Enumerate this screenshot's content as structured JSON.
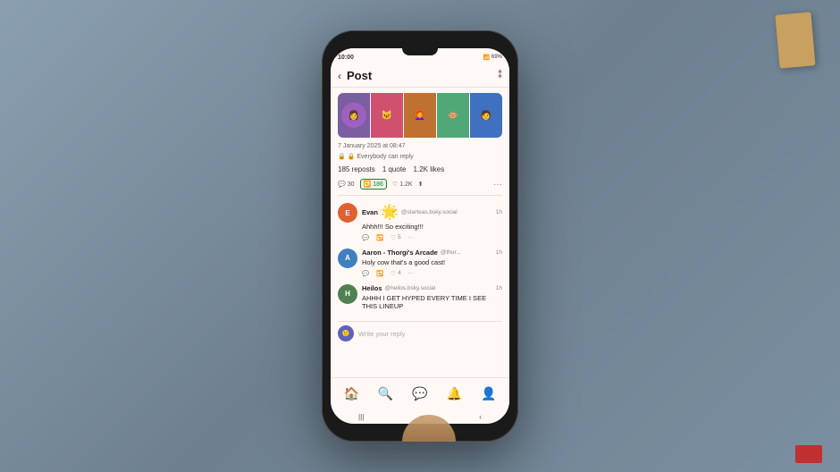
{
  "status_bar": {
    "time": "10:00",
    "battery": "69%",
    "signal_icons": "▲▼ 📶"
  },
  "header": {
    "title": "Post",
    "back_label": "‹",
    "icon": "⁑"
  },
  "post": {
    "date": "7 January 2025 at 08:47",
    "reply_note": "🔒 Everybody can reply",
    "reposts": "185 reposts",
    "quote": "1 quote",
    "likes": "1.2K likes"
  },
  "action_bar": {
    "comment_count": "30",
    "repost_count": "186",
    "like_count": "1.2K",
    "comment_icon": "💬",
    "repost_icon": "🔁",
    "like_icon": "♡",
    "share_icon": "⬆",
    "more_icon": "···"
  },
  "comments": [
    {
      "name": "Evan",
      "emoji": "🌟",
      "handle": "@starteas.bsky.social",
      "time": "1h",
      "text": "Ahhh!!! So exciting!!!",
      "avatar_color": "#e06030",
      "avatar_letter": "E",
      "actions": {
        "reply": "",
        "repost": "",
        "likes": "5",
        "more": "···"
      }
    },
    {
      "name": "Aaron - Thorgi's Arcade",
      "handle": "@thor...",
      "time": "1h",
      "text": "Holy cow that's a good cast!",
      "avatar_color": "#4080c0",
      "avatar_letter": "A",
      "actions": {
        "reply": "",
        "repost": "",
        "likes": "4",
        "more": "···"
      }
    },
    {
      "name": "Heilos",
      "handle": "@heilos.bsky.social",
      "time": "1h",
      "text": "AHHH I GET HYPED EVERY TIME I SEE THIS LINEUP",
      "avatar_color": "#508050",
      "avatar_letter": "H",
      "actions": {}
    }
  ],
  "write_reply": {
    "placeholder": "Write your reply"
  },
  "bottom_nav": {
    "items": [
      "🏠",
      "🔍",
      "💬",
      "🔔",
      "👤"
    ]
  },
  "android_nav": {
    "items": [
      "|||",
      "○",
      "‹"
    ]
  }
}
